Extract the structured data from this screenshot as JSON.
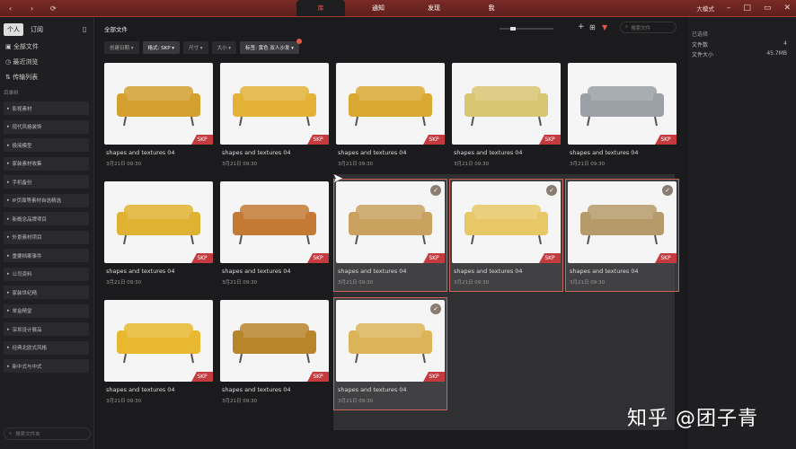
{
  "topbar": {
    "back": "‹",
    "forward": "›",
    "refresh": "⟳",
    "tabs": [
      "库",
      "通知",
      "发现",
      "我"
    ],
    "mode": "大模式",
    "window_controls": [
      "–",
      "□",
      "▭",
      "✕"
    ]
  },
  "sidebar": {
    "seg_left": "个人",
    "seg_right": "订阅",
    "all_files": "全部文件",
    "recent": "最近浏览",
    "transfers": "传输列表",
    "section": "目录树",
    "folders": [
      "影视素材",
      "现代风格装饰",
      "极简模型",
      "家装素材收集",
      "手机备份",
      "IP页面等素材自选精选",
      "新概念品牌项目",
      "外景素材项目",
      "重要档案事件",
      "公司资料",
      "家装世纪精",
      "单盒精堂",
      "深圳设计展品",
      "经典北欧式风格",
      "新中式与中式"
    ],
    "search_placeholder": "搜索文件夹"
  },
  "main": {
    "title": "全部文件",
    "search_placeholder": "搜索文件",
    "filters": [
      "创建日期 ▾",
      "格式: SKP ▾",
      "尺寸 ▾",
      "大小 ▾",
      "标签: 黄色 双人沙发 ▾"
    ],
    "cards": [
      {
        "name": "shapes and textures 04",
        "date": "3月21日 09:30",
        "badge": "SKP",
        "color": "#d4a030",
        "selected": false
      },
      {
        "name": "shapes and textures 04",
        "date": "3月21日 09:30",
        "badge": "SKP",
        "color": "#e3b237",
        "selected": false
      },
      {
        "name": "shapes and textures 04",
        "date": "3月21日 09:30",
        "badge": "SKP",
        "color": "#d9a932",
        "selected": false
      },
      {
        "name": "shapes and textures 04",
        "date": "3月21日 09:30",
        "badge": "SKP",
        "color": "#d8c672",
        "selected": false
      },
      {
        "name": "shapes and textures 04",
        "date": "3月21日 09:30",
        "badge": "SKP",
        "color": "#9aa0a6",
        "selected": false
      },
      {
        "name": "shapes and textures 04",
        "date": "3月21日 09:30",
        "badge": "SKP",
        "color": "#e0b232",
        "selected": false
      },
      {
        "name": "shapes and textures 04",
        "date": "3月21日 09:30",
        "badge": "SKP",
        "color": "#c47a35",
        "selected": false
      },
      {
        "name": "shapes and textures 04",
        "date": "3月21日 09:30",
        "badge": "SKP",
        "color": "#c8a25e",
        "selected": true
      },
      {
        "name": "shapes and textures 04",
        "date": "3月21日 09:30",
        "badge": "SKP",
        "color": "#e8c866",
        "selected": true
      },
      {
        "name": "shapes and textures 04",
        "date": "3月21日 09:30",
        "badge": "SKP",
        "color": "#b69a6a",
        "selected": true
      },
      {
        "name": "shapes and textures 04",
        "date": "3月21日 09:30",
        "badge": "SKP",
        "color": "#e8b930",
        "selected": false
      },
      {
        "name": "shapes and textures 04",
        "date": "3月21日 09:30",
        "badge": "SKP",
        "color": "#b8862a",
        "selected": false
      },
      {
        "name": "shapes and textures 04",
        "date": "3月21日 09:30",
        "badge": "SKP",
        "color": "#dcb45a",
        "selected": true
      }
    ]
  },
  "right": {
    "title": "已选择",
    "count_label": "文件数",
    "count": "4",
    "size_label": "文件大小",
    "size": "45.7MB"
  },
  "watermark": "知乎 @团子青"
}
